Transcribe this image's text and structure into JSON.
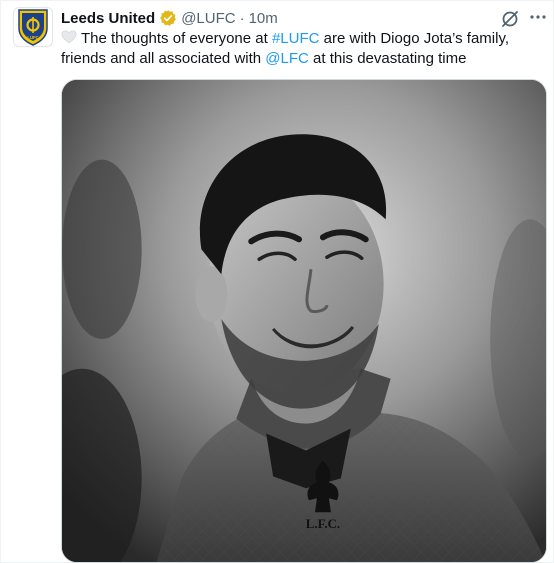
{
  "tweet": {
    "author_name": "Leeds United",
    "handle": "@LUFC",
    "separator": "·",
    "timestamp": "10m",
    "text_part1": "The thoughts of everyone at ",
    "hashtag": "#LUFC",
    "text_part2": " are with Diogo Jota’s family, friends and all associated with ",
    "mention": "@LFC",
    "text_part3": " at this devastating time",
    "crest_letters": "LUFC",
    "shirt_text": "L.F.C."
  },
  "icons": {
    "verified": "gold-verified-badge-icon",
    "grok": "grok-icon",
    "more": "more-icon",
    "heart": "white-heart-icon"
  },
  "colors": {
    "link": "#1d9bf0",
    "verified_gold": "#e2b719",
    "crest_yellow": "#f5c400",
    "crest_blue": "#1d428a",
    "text": "#0f1419",
    "secondary": "#536471"
  }
}
